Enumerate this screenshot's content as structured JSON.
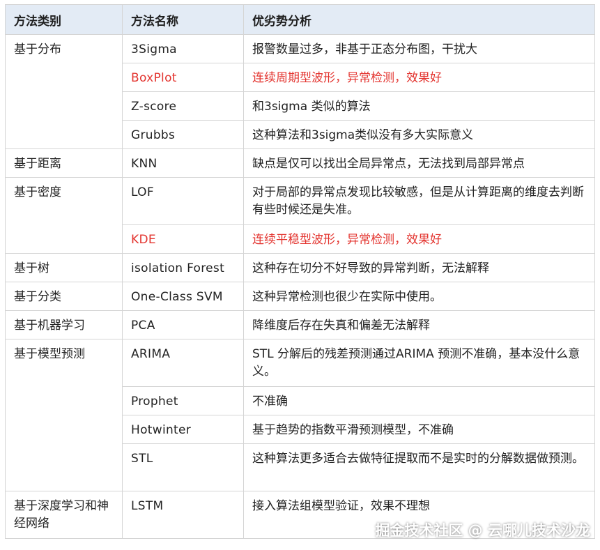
{
  "header": {
    "category": "方法类别",
    "method": "方法名称",
    "analysis": "优劣势分析"
  },
  "rows": [
    {
      "category": "基于分布",
      "method": "3Sigma",
      "analysis": "报警数量过多，非基于正态分布图，干扰大"
    },
    {
      "method": "BoxPlot",
      "analysis": "连续周期型波形，异常检测，效果好",
      "highlight": true
    },
    {
      "method": "Z-score",
      "analysis": "和3sigma 类似的算法"
    },
    {
      "method": "Grubbs",
      "analysis": "这种算法和3sigma类似没有多大实际意义"
    },
    {
      "category": "基于距离",
      "method": "KNN",
      "analysis": "缺点是仅可以找出全局异常点，无法找到局部异常点"
    },
    {
      "category": "基于密度",
      "method": "LOF",
      "analysis": "对于局部的异常点发现比较敏感，但是从计算距离的维度去判断有些时候还是失准。"
    },
    {
      "method": "KDE",
      "analysis": "连续平稳型波形，异常检测，效果好",
      "highlight": true
    },
    {
      "category": "基于树",
      "method": "isolation Forest",
      "analysis": "这种存在切分不好导致的异常判断，无法解释"
    },
    {
      "category": "基于分类",
      "method": "One-Class SVM",
      "analysis": "这种异常检测也很少在实际中使用。"
    },
    {
      "category": "基于机器学习",
      "method": "PCA",
      "analysis": "降维度后存在失真和偏差无法解释"
    },
    {
      "category": "基于模型预测",
      "method": "ARIMA",
      "analysis": "STL 分解后的残差预测通过ARIMA 预测不准确，基本没什么意义。"
    },
    {
      "method": "Prophet",
      "analysis": "不准确"
    },
    {
      "method": "Hotwinter",
      "analysis": "基于趋势的指数平滑预测模型，不准确"
    },
    {
      "method": "STL",
      "analysis": "这种算法更多适合去做特征提取而不是实时的分解数据做预测。"
    },
    {
      "category": "基于深度学习和神经网络",
      "method": "LSTM",
      "analysis": "接入算法组模型验证，效果不理想"
    }
  ],
  "watermark": "掘金技术社区 @ 云哪儿技术沙龙",
  "colors": {
    "header_bg": "#e3ebf5",
    "highlight": "#e3342f",
    "border": "#d5d5d5"
  }
}
